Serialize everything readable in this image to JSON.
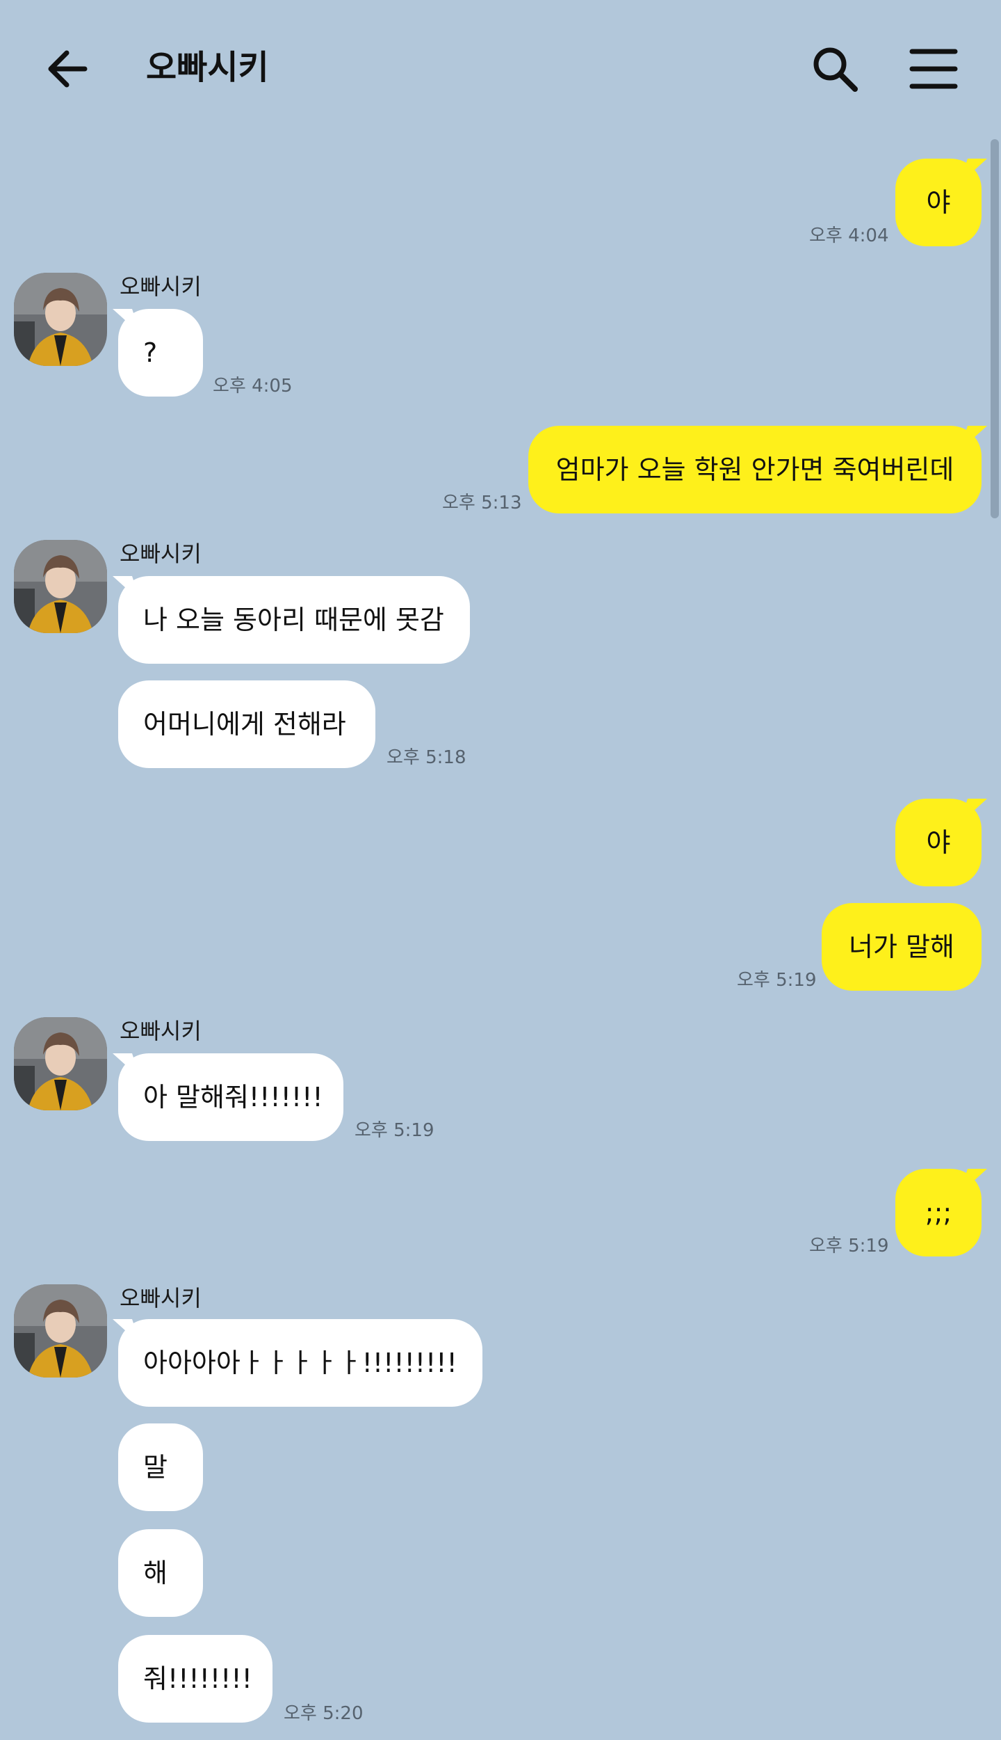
{
  "header": {
    "title": "오빠시키"
  },
  "chat": {
    "m1": {
      "text": "야",
      "time": "오후 4:04"
    },
    "g1": {
      "sender": "오빠시키",
      "text": "?",
      "time": "오후 4:05"
    },
    "m2": {
      "text": "엄마가 오늘 학원 안가면 죽여버린데",
      "time": "오후 5:13"
    },
    "g2": {
      "sender": "오빠시키",
      "text1": "나 오늘 동아리 때문에 못감",
      "text2": "어머니에게 전해라",
      "time": "오후 5:18"
    },
    "m3": {
      "text1": "야",
      "text2": "너가 말해",
      "time": "오후 5:19"
    },
    "g3": {
      "sender": "오빠시키",
      "text": "아 말해줘!!!!!!!",
      "time": "오후 5:19"
    },
    "m4": {
      "text": ";;;",
      "time": "오후 5:19"
    },
    "g4": {
      "sender": "오빠시키",
      "text1": "아아아아ㅏㅏㅏㅏㅏ!!!!!!!!!",
      "text2": "말",
      "text3": "해",
      "text4": "줘!!!!!!!!",
      "time": "오후 5:20"
    }
  },
  "colors": {
    "background": "#b2c7da",
    "my_bubble": "#fef01b",
    "other_bubble": "#ffffff"
  },
  "icons": {
    "back": "arrow-left-icon",
    "search": "search-icon",
    "menu": "hamburger-menu-icon"
  }
}
